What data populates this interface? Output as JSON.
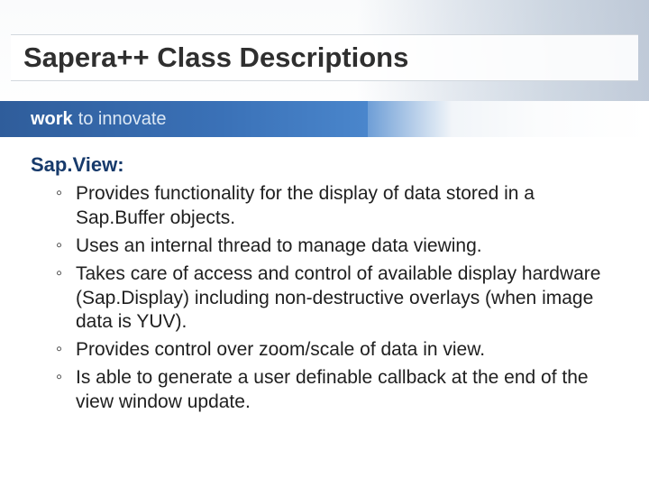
{
  "slide": {
    "title": "Sapera++ Class Descriptions",
    "tagline_bold": "work",
    "tagline_rest": "to innovate",
    "section_heading": "Sap.View:",
    "bullets": [
      "Provides functionality for the display of data stored in a Sap.Buffer objects.",
      "Uses an internal thread to manage data viewing.",
      "Takes care of access and control of available display hardware (Sap.Display) including non-destructive overlays (when image data is YUV).",
      "Provides control over zoom/scale of data in view.",
      "Is able to generate a user definable callback at the end of the view window update."
    ]
  }
}
